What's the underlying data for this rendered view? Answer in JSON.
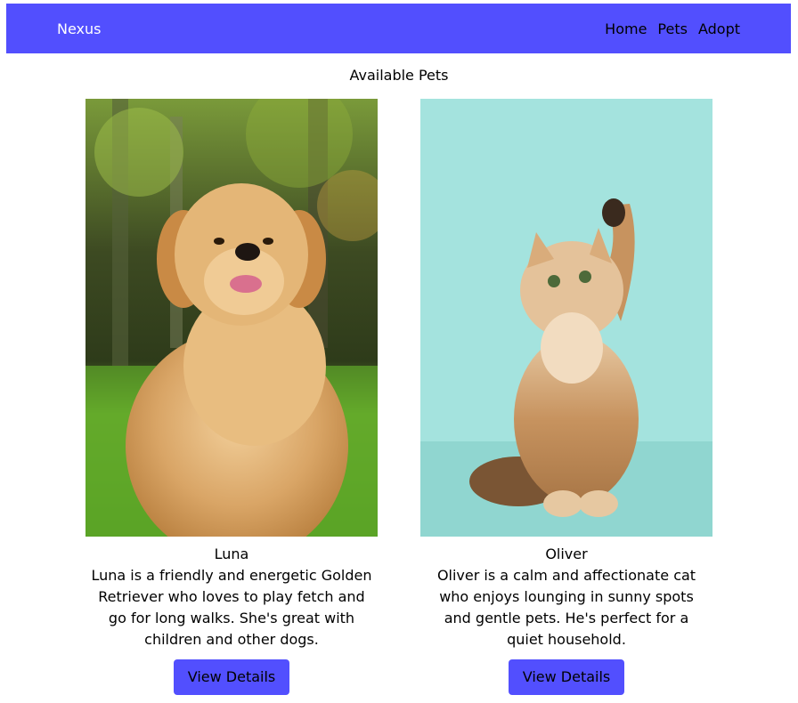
{
  "header": {
    "brand": "Nexus",
    "nav": [
      "Home",
      "Pets",
      "Adopt"
    ]
  },
  "main": {
    "title": "Available Pets",
    "pets": [
      {
        "name": "Luna",
        "description": "Luna is a friendly and energetic Golden Retriever who loves to play fetch and go for long walks. She's great with children and other dogs.",
        "button": "View Details",
        "image": "golden-retriever-photo"
      },
      {
        "name": "Oliver",
        "description": "Oliver is a calm and affectionate cat who enjoys lounging in sunny spots and gentle pets. He's perfect for a quiet household.",
        "button": "View Details",
        "image": "kitten-photo"
      }
    ]
  },
  "colors": {
    "accent": "#524ffe",
    "background": "#ffffff"
  }
}
